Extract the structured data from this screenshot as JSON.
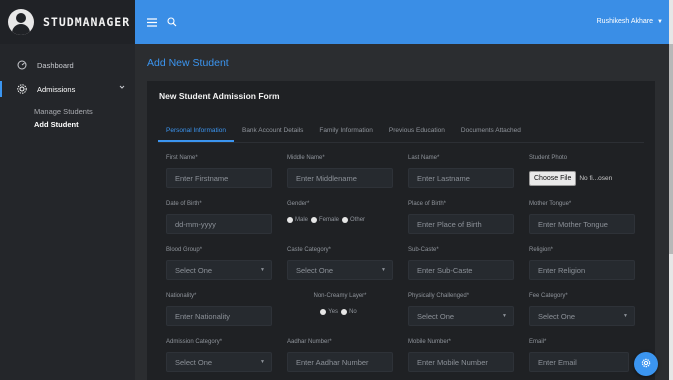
{
  "brand": {
    "name": "STUDMANAGER"
  },
  "sidebar": {
    "items": [
      {
        "label": "Dashboard"
      },
      {
        "label": "Admissions"
      }
    ],
    "subitems": [
      {
        "label": "Manage Students"
      },
      {
        "label": "Add Student"
      }
    ]
  },
  "topbar": {
    "user_name": "Rushikesh Akhare"
  },
  "page": {
    "title": "Add New Student"
  },
  "form": {
    "title": "New Student Admission Form",
    "tabs": [
      "Personal Information",
      "Bank Account Details",
      "Family Information",
      "Previous Education",
      "Documents Attached"
    ],
    "fields": {
      "first_name": {
        "label": "First Name*",
        "placeholder": "Enter Firstname"
      },
      "middle_name": {
        "label": "Middle Name*",
        "placeholder": "Enter Middlename"
      },
      "last_name": {
        "label": "Last Name*",
        "placeholder": "Enter Lastname"
      },
      "student_photo": {
        "label": "Student Photo",
        "button": "Choose File",
        "status": "No fi...osen"
      },
      "dob": {
        "label": "Date of Birth*",
        "placeholder": "dd-mm-yyyy"
      },
      "gender": {
        "label": "Gender*",
        "options": [
          "Male",
          "Female",
          "Other"
        ]
      },
      "place_of_birth": {
        "label": "Place of Birth*",
        "placeholder": "Enter Place of Birth"
      },
      "mother_tongue": {
        "label": "Mother Tongue*",
        "placeholder": "Enter Mother Tongue"
      },
      "blood_group": {
        "label": "Blood Group*",
        "value": "Select One"
      },
      "caste_category": {
        "label": "Caste Category*",
        "value": "Select One"
      },
      "sub_caste": {
        "label": "Sub-Caste*",
        "placeholder": "Enter Sub-Caste"
      },
      "religion": {
        "label": "Religion*",
        "placeholder": "Enter Religion"
      },
      "nationality": {
        "label": "Nationality*",
        "placeholder": "Enter Nationality"
      },
      "non_creamy": {
        "label": "Non-Creamy Layer*",
        "options": [
          "Yes",
          "No"
        ]
      },
      "physically_challenged": {
        "label": "Physically Challenged*",
        "value": "Select One"
      },
      "fee_category": {
        "label": "Fee Category*",
        "value": "Select One"
      },
      "admission_category": {
        "label": "Admission Category*",
        "value": "Select One"
      },
      "aadhar": {
        "label": "Aadhar Number*",
        "placeholder": "Enter Aadhar Number"
      },
      "mobile": {
        "label": "Mobile Number*",
        "placeholder": "Enter Mobile Number"
      },
      "email": {
        "label": "Email*",
        "placeholder": "Enter Email"
      }
    }
  },
  "colors": {
    "accent": "#3b95f0",
    "topbar": "#3a8ee6",
    "sidebar": "#24262a",
    "card": "#1f2124"
  }
}
